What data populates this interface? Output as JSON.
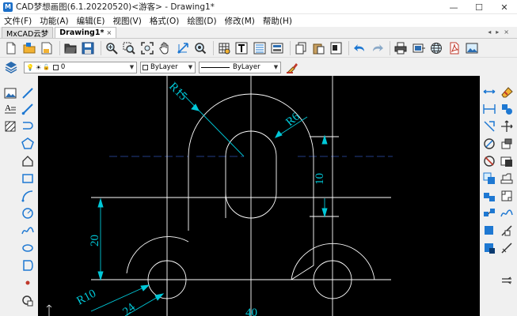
{
  "window": {
    "title": "CAD梦想画图(6.1.20220520)<游客> - Drawing1*",
    "minimize": "—",
    "maximize": "☐",
    "close": "✕"
  },
  "menu": [
    "文件(F)",
    "功能(A)",
    "编辑(E)",
    "视图(V)",
    "格式(O)",
    "绘图(D)",
    "修改(M)",
    "帮助(H)"
  ],
  "tabs": {
    "home": "MxCAD云梦",
    "doc": "Drawing1*",
    "close": "×",
    "controls": "◂▸×"
  },
  "layer_bar": {
    "layer_value": "0",
    "color_value": "ByLayer",
    "linetype_value": "ByLayer"
  },
  "drawing": {
    "dim_r15": "R15",
    "dim_r6": "R6",
    "dim_10": "10",
    "dim_20": "20",
    "dim_r10": "R10",
    "dim_24": "24",
    "dim_40": "40"
  },
  "colors": {
    "canvas": "#000000",
    "geometry": "#ffffff",
    "dimension": "#00c8d8",
    "centerline": "#1e3a8a"
  },
  "icons": {
    "toolbar1": [
      "new-icon",
      "open-folder-icon",
      "save-icon",
      "open-icon",
      "save-as-icon",
      "zoom-realtime-icon",
      "zoom-window-icon",
      "zoom-extents-icon",
      "pan-hand-icon",
      "zoom-previous-icon",
      "zoom-in-icon",
      "table-icon",
      "text-style-icon",
      "properties-icon",
      "layer-manager-icon",
      "copy-icon",
      "paste-icon",
      "cut-icon",
      "undo-icon",
      "redo-icon",
      "print-icon",
      "export-icon",
      "web-icon",
      "pdf-icon",
      "image-icon"
    ],
    "left": [
      "layers-icon",
      "image-insert-icon",
      "line-icon",
      "text-icon",
      "ray-icon",
      "hatch-icon",
      "multiline-icon",
      "polygon-icon",
      "polyline-icon",
      "rectangle-icon",
      "arc-icon",
      "circle-icon",
      "spline-icon",
      "ellipse-icon",
      "point-icon",
      "region-icon"
    ],
    "right": [
      "eraser-icon",
      "distance-icon",
      "copy-object-icon",
      "measure-icon",
      "move-icon",
      "rotate-icon",
      "scale-icon",
      "offset-icon",
      "trim-icon",
      "extend-icon",
      "array-icon",
      "break-icon",
      "fillet-icon",
      "explode-icon",
      "stretch-icon"
    ]
  }
}
